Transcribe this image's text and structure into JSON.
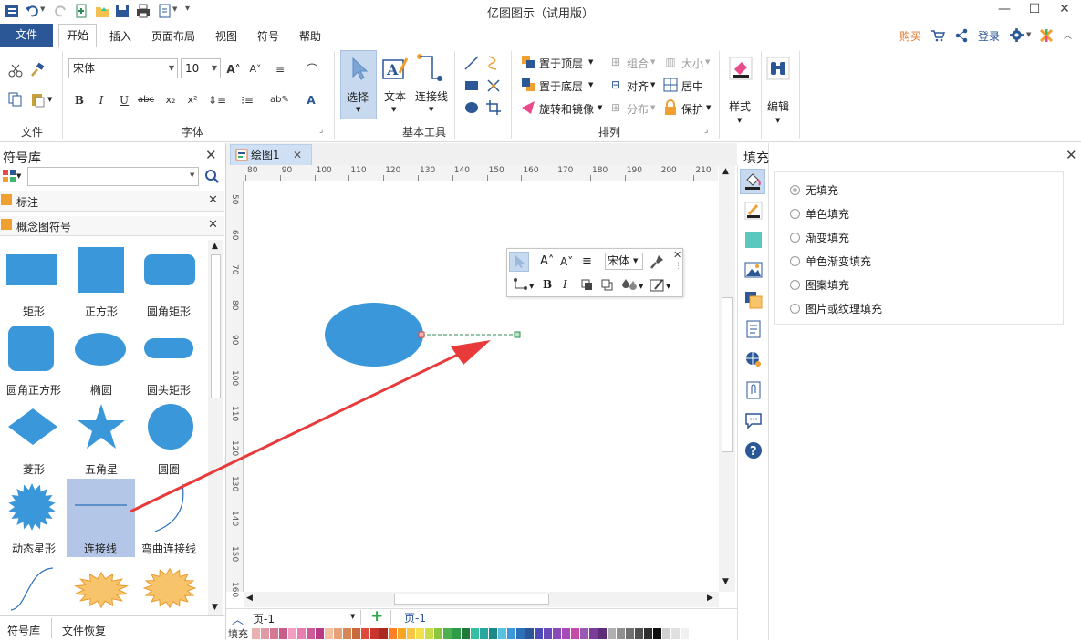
{
  "app": {
    "title": "亿图图示（试用版）",
    "window_controls": [
      "minimize-icon",
      "maximize-icon",
      "close-icon"
    ]
  },
  "menu": {
    "file": "文件",
    "tabs": [
      "开始",
      "插入",
      "页面布局",
      "视图",
      "符号",
      "帮助"
    ],
    "active_tab": "开始",
    "right": {
      "buy": "购买",
      "login": "登录"
    }
  },
  "ribbon": {
    "groups": {
      "file": "文件",
      "font": "字体",
      "basic_tools": "基本工具",
      "arrange": "排列"
    },
    "font": {
      "family": "宋体",
      "size": "10"
    },
    "tools": {
      "select": "选择",
      "text": "文本",
      "connector": "连接线"
    },
    "arrange": {
      "bring_front": "置于顶层",
      "send_back": "置于底层",
      "rotate_mirror": "旋转和镜像",
      "group": "组合",
      "align": "对齐",
      "distribute": "分布",
      "size": "大小",
      "center": "居中",
      "protect": "保护"
    },
    "style": "样式",
    "edit": "编辑"
  },
  "library": {
    "title": "符号库",
    "search": {
      "value": "",
      "placeholder": ""
    },
    "sections": [
      "标注",
      "概念图符号"
    ],
    "shapes": [
      "矩形",
      "正方形",
      "圆角矩形",
      "圆角正方形",
      "椭圆",
      "圆头矩形",
      "菱形",
      "五角星",
      "圆圈",
      "动态星形",
      "连接线",
      "弯曲连接线",
      "",
      "",
      ""
    ],
    "selected_shape": "连接线",
    "bottom_tabs": [
      "符号库",
      "文件恢复"
    ]
  },
  "document": {
    "tab": "绘图1",
    "hruler_ticks": [
      "80",
      "90",
      "100",
      "110",
      "120",
      "130",
      "140",
      "150",
      "160",
      "170",
      "180",
      "190",
      "200",
      "210"
    ],
    "vruler_ticks": [
      "50",
      "60",
      "70",
      "80",
      "90",
      "100",
      "110",
      "120",
      "130",
      "140",
      "150",
      "160"
    ],
    "page_select": "页-1",
    "page_tab": "页-1",
    "fill_label": "填充"
  },
  "floating_toolbar": {
    "font_value": "宋体"
  },
  "fill_panel": {
    "title": "填充",
    "options": [
      "无填充",
      "单色填充",
      "渐变填充",
      "单色渐变填充",
      "图案填充",
      "图片或纹理填充"
    ],
    "selected": "无填充"
  },
  "colors": {
    "accent": "#2b5797",
    "shape_blue": "#3a97d9",
    "annotation_arrow": "#e83a3a",
    "selected_cell": "#b4c6e7",
    "star_fill": "#f7c46b"
  },
  "palette": [
    "#e8b0b0",
    "#e09aa5",
    "#d47896",
    "#c95d8a",
    "#f29ec3",
    "#e77eaf",
    "#cf5a98",
    "#b83a84",
    "#f3c0a0",
    "#e7a27a",
    "#d78656",
    "#c96a3a",
    "#e04a3a",
    "#c9352c",
    "#a82a20",
    "#ff7f27",
    "#f5a623",
    "#f8c545",
    "#f5e04a",
    "#c8dc4a",
    "#8cc63f",
    "#4caf50",
    "#2e9b46",
    "#1f7a3a",
    "#34bfa3",
    "#2aa6a0",
    "#1c8a8a",
    "#5bc0de",
    "#3a97d9",
    "#2b6fb8",
    "#2b5797",
    "#4a4ab8",
    "#6a4ab8",
    "#8a4ab8",
    "#a84ab8",
    "#c84aa8",
    "#9b59b6",
    "#7d3c98",
    "#5d2d78",
    "#b0b0b0",
    "#909090",
    "#707070",
    "#505050",
    "#303030",
    "#101010",
    "#d0d0d0",
    "#e0e0e0",
    "#f0f0f0"
  ]
}
